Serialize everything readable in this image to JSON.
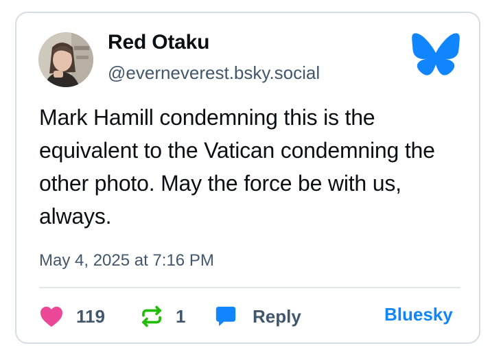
{
  "post": {
    "author": {
      "display_name": "Red Otaku",
      "handle": "@everneverest.bsky.social",
      "avatar": "profile-photo"
    },
    "text": "Mark Hamill condemning this is the equivalent to the Vatican condemning the other photo. May the force be with us, always.",
    "timestamp": "May 4, 2025 at 7:16 PM"
  },
  "actions": {
    "like": {
      "icon": "heart-icon",
      "count": "119",
      "color": "#ec4899"
    },
    "repost": {
      "icon": "repost-icon",
      "count": "1",
      "color": "#20bc07"
    },
    "reply": {
      "icon": "reply-bubble-icon",
      "label": "Reply",
      "color": "#1185fe"
    },
    "open_link": "Bluesky"
  },
  "brand": {
    "logo": "bluesky-butterfly-icon",
    "accent": "#1185fe"
  }
}
